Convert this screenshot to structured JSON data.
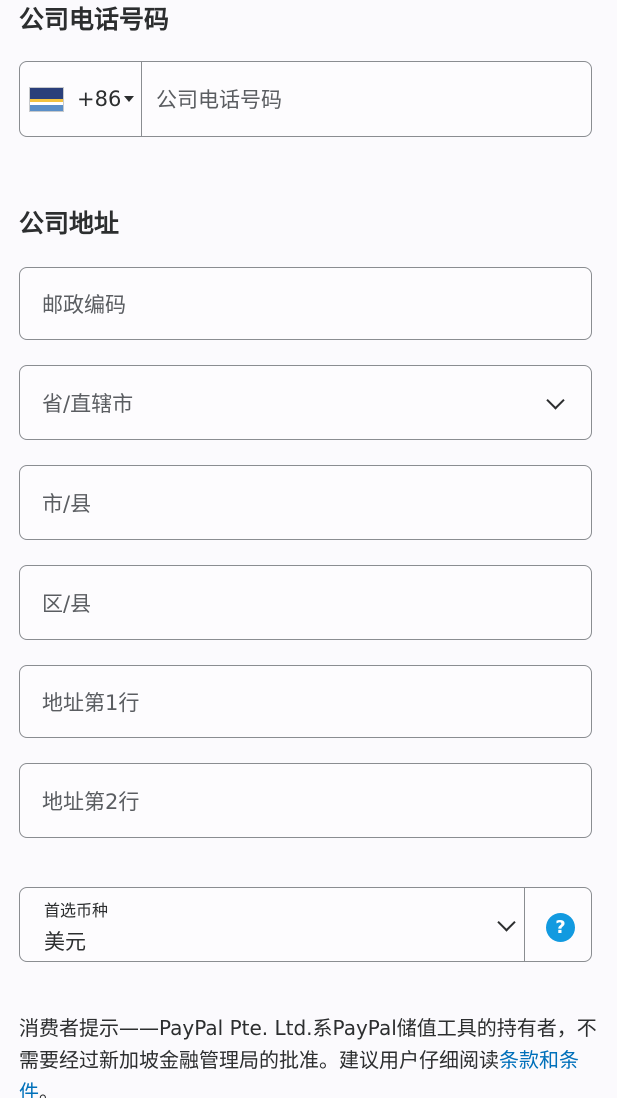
{
  "phone_section": {
    "title": "公司电话号码",
    "country_code": "+86",
    "flag_icon": "flag-icon",
    "placeholder": "公司电话号码"
  },
  "address_section": {
    "title": "公司地址",
    "postal_code": "邮政编码",
    "province": "省/直辖市",
    "city": "市/县",
    "district": "区/县",
    "address_line1": "地址第1行",
    "address_line2": "地址第2行"
  },
  "currency": {
    "label": "首选币种",
    "value": "美元",
    "help_icon": "?"
  },
  "disclaimer": {
    "text": "消费者提示——PayPal Pte. Ltd.系PayPal储值工具的持有者，不需要经过新加坡金融管理局的批准。建议用户仔细阅读",
    "link": "条款和条件",
    "end": "。"
  },
  "colors": {
    "border": "#8a8d91",
    "link": "#0070ba",
    "help_icon_bg": "#129ae0"
  }
}
